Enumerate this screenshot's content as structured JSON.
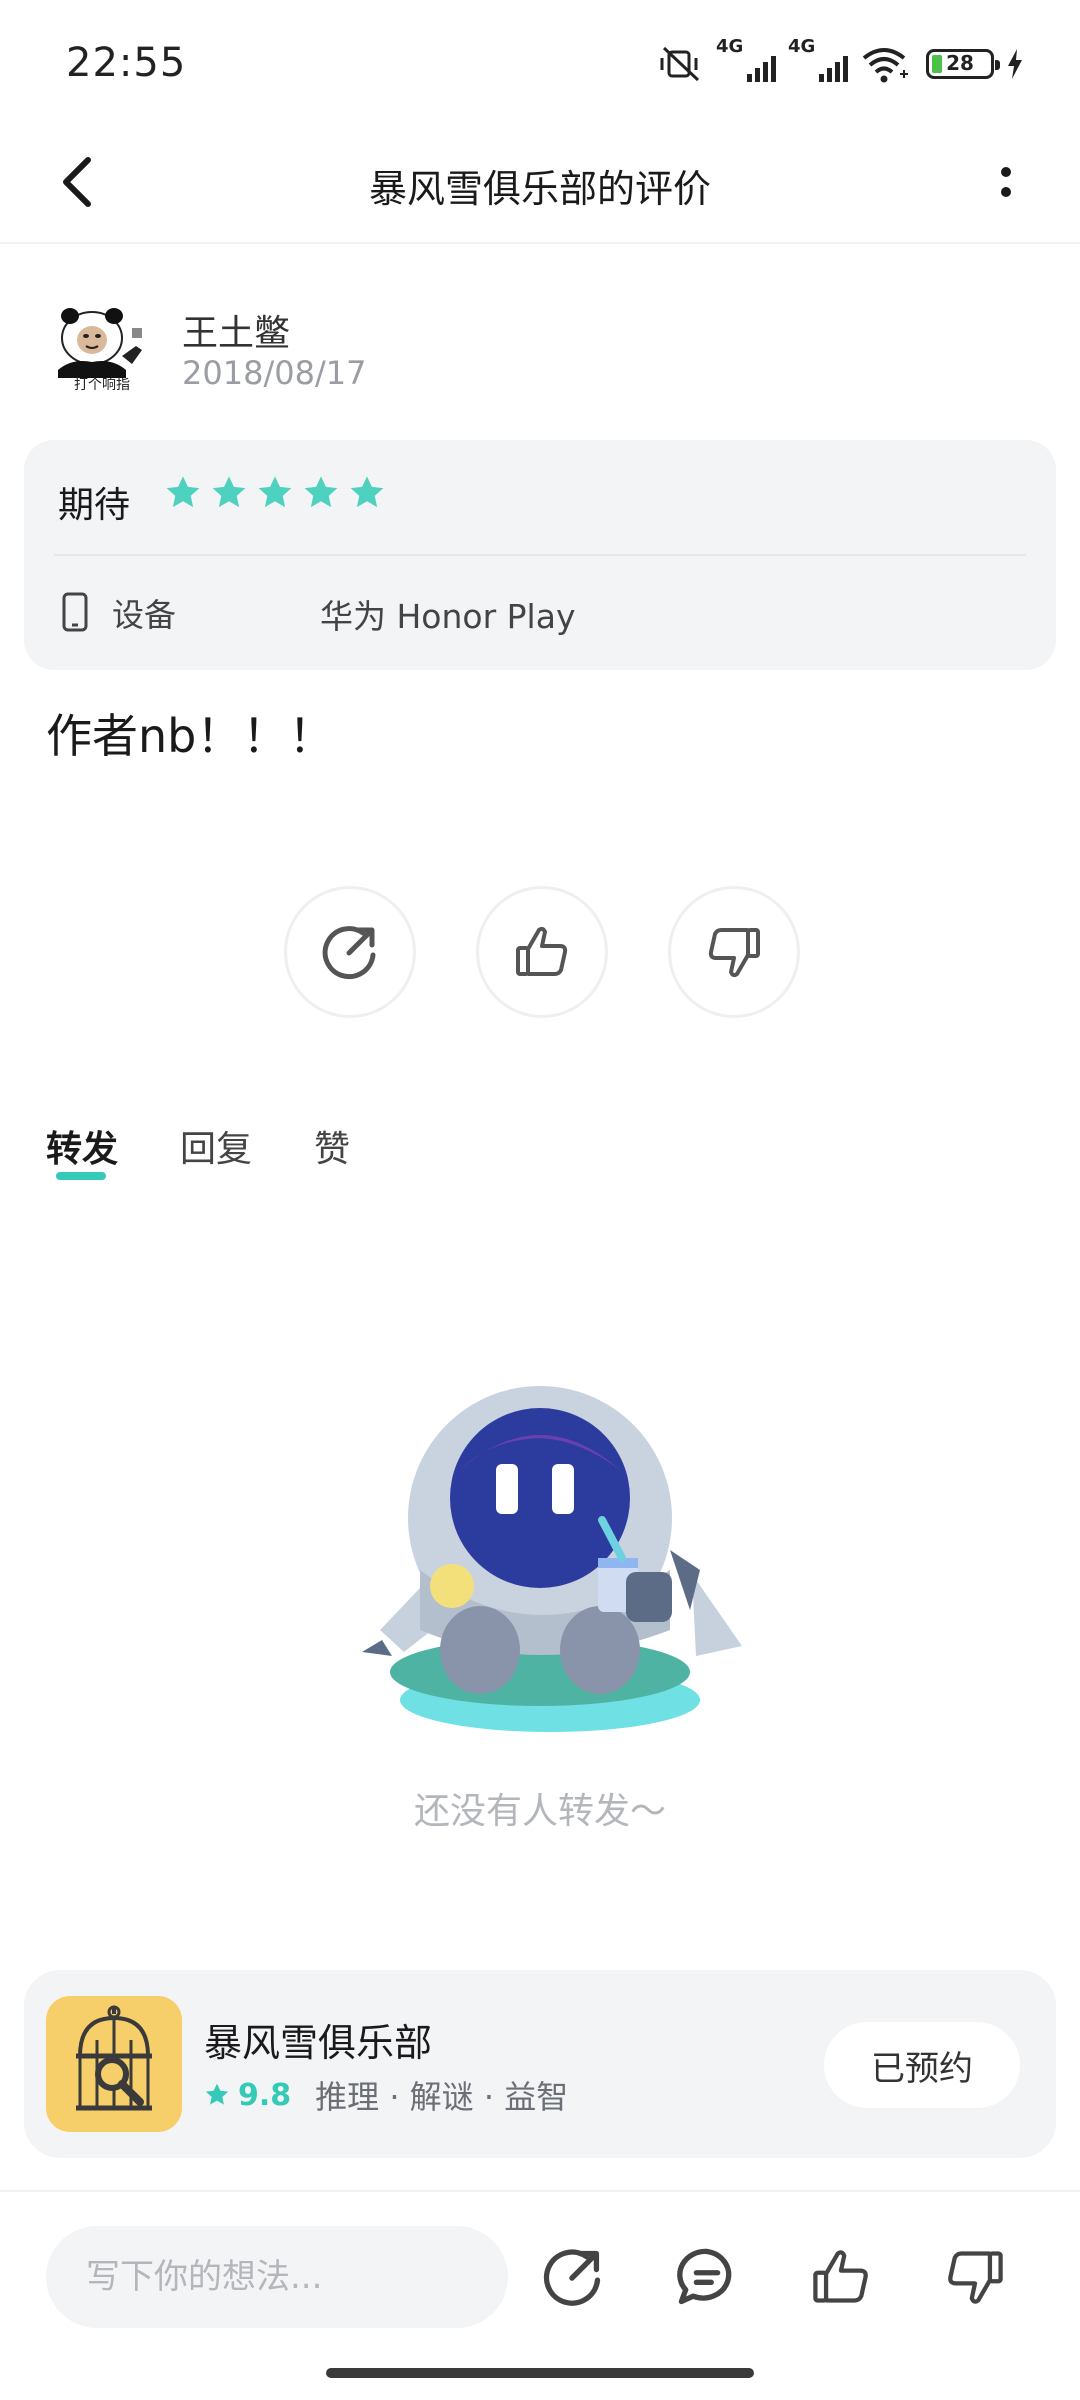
{
  "status_bar": {
    "time": "22:55",
    "signal1_label": "4G",
    "signal2_label": "4G",
    "battery_level": "28"
  },
  "header": {
    "title": "暴风雪俱乐部的评价"
  },
  "review": {
    "author_name": "王土鳖",
    "avatar_caption": "打个响指",
    "date": "2018/08/17",
    "rating_label": "期待",
    "stars": 5,
    "device_label": "设备",
    "device_value": "华为 Honor Play",
    "text": "作者nb！！！"
  },
  "tabs": [
    {
      "label": "转发",
      "active": true
    },
    {
      "label": "回复",
      "active": false
    },
    {
      "label": "赞",
      "active": false
    }
  ],
  "empty_state": {
    "text": "还没有人转发～"
  },
  "game": {
    "name": "暴风雪俱乐部",
    "rating": "9.8",
    "tags": "推理 · 解谜 · 益智",
    "button_label": "已预约"
  },
  "bottom_bar": {
    "placeholder": "写下你的想法..."
  },
  "colors": {
    "accent": "#35c9b8",
    "card_bg": "#f3f4f6",
    "muted_text": "#9a9da3"
  }
}
